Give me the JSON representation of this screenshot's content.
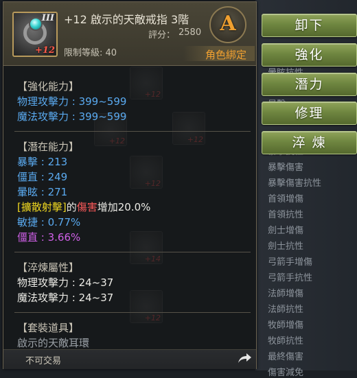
{
  "item": {
    "tier_mark": "III",
    "enhance_mark": "+12",
    "name": "+12 啟示的天敵戒指 3階",
    "rating_label": "評分：",
    "rating_value": "2580",
    "required_level": "限制等級: 40",
    "grade": "A",
    "bind_status": "角色綁定"
  },
  "buttons": {
    "unequip": "卸下",
    "enhance": "強化",
    "potential": "潛力",
    "repair": "修理",
    "refine": "淬 煉"
  },
  "sections": {
    "enhance_title": "【強化能力】",
    "enhance_lines": [
      "物理攻擊力 : 399~599",
      "魔法攻擊力 : 399~599"
    ],
    "potential_title": "【潛在能力】",
    "potential_lines": [
      "暴擊 : 213",
      "僵直 : 249",
      "暈眩 : 271"
    ],
    "potential_skill": "[擴散射擊]",
    "potential_skill_mid": "的",
    "potential_skill_damage": "傷害",
    "potential_skill_rest": "增加20.0%",
    "potential_extra": [
      "敏捷 : 0.77%",
      "僵直 : 3.66%"
    ],
    "refine_title": "【淬煉屬性】",
    "refine_lines": [
      "物理攻擊力 : 24~37",
      "魔法攻擊力 : 24~37"
    ],
    "set_title": "【套裝道具】",
    "set_item": "啟示的天敵耳環"
  },
  "footer": {
    "trade": "不可交易"
  },
  "background_list": {
    "items": [
      "暈眩抗性",
      "暴擊",
      "暴擊抗性",
      "暴擊傷害",
      "暴擊傷害抗性",
      "首領增傷",
      "首領抗性",
      "劍士增傷",
      "劍士抗性",
      "弓箭手增傷",
      "弓箭手抗性",
      "法師增傷",
      "法師抗性",
      "牧師增傷",
      "牧師抗性",
      "最終傷害",
      "傷害減免"
    ]
  },
  "ghost_icons": [
    "+12",
    "+12",
    "+12",
    "+12",
    "+14",
    "+12"
  ],
  "colors": {
    "accent_orange": "#f0a030",
    "button_green": "#6f8640",
    "stat_blue": "#5aaaf0",
    "stat_purple": "#d060e8",
    "skill_yellow": "#f0d820",
    "damage_red": "#ff5a5a"
  },
  "icons": {
    "item": "ring-with-cyan-gem-icon",
    "share": "share-arrow-icon"
  }
}
